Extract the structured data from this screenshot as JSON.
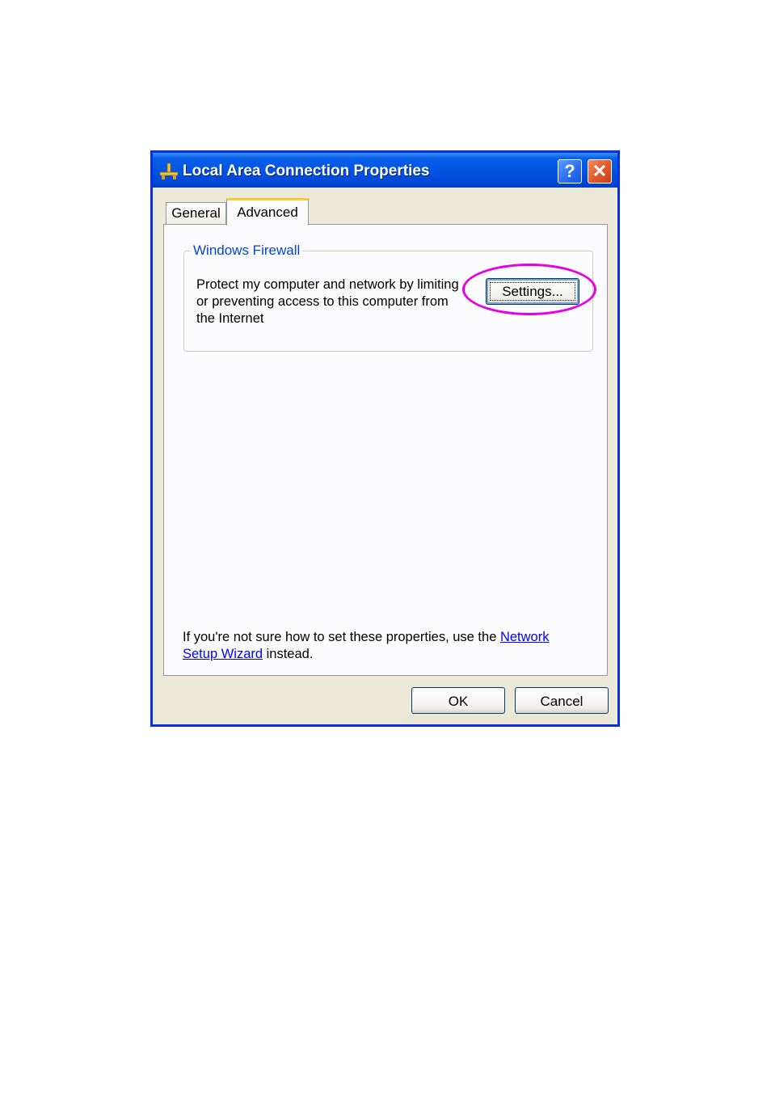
{
  "window": {
    "title": "Local Area Connection Properties",
    "icon": "network-connection-icon",
    "help_label": "?",
    "close_label": "✕"
  },
  "tabs": [
    {
      "label": "General",
      "selected": false
    },
    {
      "label": "Advanced",
      "selected": true
    }
  ],
  "firewall": {
    "group_label": "Windows Firewall",
    "description": "Protect my computer and network by limiting or preventing access to this computer from the Internet",
    "settings_button": "Settings..."
  },
  "footer": {
    "help_prefix": "If you're not sure how to set these properties, use the ",
    "link_text": "Network Setup Wizard",
    "help_suffix": " instead."
  },
  "buttons": {
    "ok": "OK",
    "cancel": "Cancel"
  },
  "colors": {
    "title_bar": "#0055e5",
    "window_border": "#0831d9",
    "highlight": "#e600e6",
    "link": "#0000ff"
  }
}
